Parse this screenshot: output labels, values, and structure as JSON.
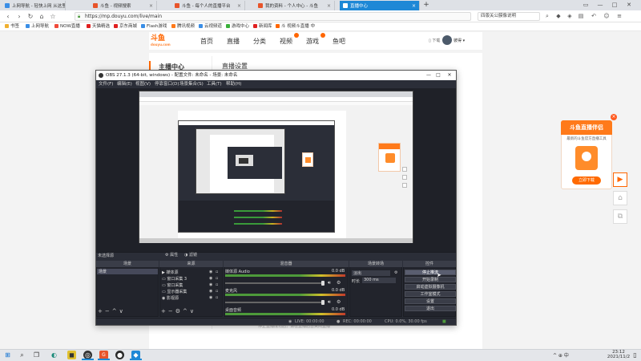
{
  "browser": {
    "tabs": [
      {
        "label": "上网导航 - 轻快上网 从这里开始"
      },
      {
        "label": "斗鱼 - 视频搜索"
      },
      {
        "label": "斗鱼 - 每个人的直播平台"
      },
      {
        "label": "我的资料 - 个人中心 - 斗鱼"
      },
      {
        "label": "直播中心"
      }
    ],
    "new_tab": "+",
    "url": "https://mp.douyu.com/live/main",
    "search_text": "四版关公膜像说明",
    "bookmarks": [
      {
        "label": "书签",
        "color": "#f0b030"
      },
      {
        "label": "上网导航",
        "color": "#3a8ee6"
      },
      {
        "label": "NOW直播",
        "color": "#f04a3a"
      },
      {
        "label": "天猫精选",
        "color": "#e02020"
      },
      {
        "label": "京东商城",
        "color": "#e02020"
      },
      {
        "label": "Flash游戏",
        "color": "#3a8ee6"
      },
      {
        "label": "腾讯视频",
        "color": "#ff7a1a"
      },
      {
        "label": "云视频道",
        "color": "#3a8ee6"
      },
      {
        "label": "游戏中心",
        "color": "#3ab03a"
      },
      {
        "label": "新闻库",
        "color": "#e02020"
      },
      {
        "label": "斗 视频斗直播 中",
        "color": "#ff6600"
      }
    ]
  },
  "site": {
    "logo_text": "斗鱼",
    "logo_sub": "douyu.com",
    "nav": [
      "首页",
      "直播",
      "分类",
      "视频",
      "游戏",
      "鱼吧"
    ],
    "download_label": "下载",
    "username": "彼得"
  },
  "main": {
    "sidebar_title": "主播中心",
    "page_title": "直播设置",
    "bottom_note": "停止直播成功后，请在直播后台关闭直播"
  },
  "promo": {
    "title": "斗鱼直播伴侣",
    "subtitle": "最新的斗鱼官方直播工具",
    "button": "立即下载",
    "close": "×"
  },
  "obs": {
    "title": "OBS 27.1.3 (64-bit, windows) - 配置文件: 未命名 - 场景: 未命名",
    "menu": [
      "文件(F)",
      "编辑(E)",
      "视图(V)",
      "停靠窗口(D)",
      "场景集合(S)",
      "工具(T)",
      "帮助(H)"
    ],
    "status_label": "未选择源",
    "props_btn": "属性",
    "filters_btn": "滤镜",
    "docks": {
      "scenes": {
        "header": "场景",
        "items": [
          "场景"
        ]
      },
      "sources": {
        "header": "来源",
        "items": [
          "媒体源",
          "窗口采集 3",
          "窗口采集",
          "显示器采集",
          "影视源"
        ]
      },
      "mixer": {
        "header": "混音器",
        "channels": [
          {
            "name": "媒体源 Audio",
            "db": "0.0 dB"
          },
          {
            "name": "麦克风",
            "db": "0.0 dB"
          },
          {
            "name": "桌面音频",
            "db": "0.0 dB"
          }
        ]
      },
      "transitions": {
        "header": "场景转场",
        "type": "淡出",
        "duration_label": "时长",
        "duration": "300 ms"
      },
      "controls": {
        "header": "控件",
        "buttons": [
          "停止推流",
          "开始录制",
          "启动虚拟摄像机",
          "工作室模式",
          "设置",
          "退出"
        ]
      }
    },
    "statusbar": {
      "live": "LIVE: 00:00:00",
      "rec": "REC: 00:00:00",
      "cpu": "CPU: 0.0%, 30.00 fps"
    }
  },
  "taskbar": {
    "tray_text": "^  ⊕  中",
    "time": "23:12",
    "date": "2021/11/2"
  }
}
